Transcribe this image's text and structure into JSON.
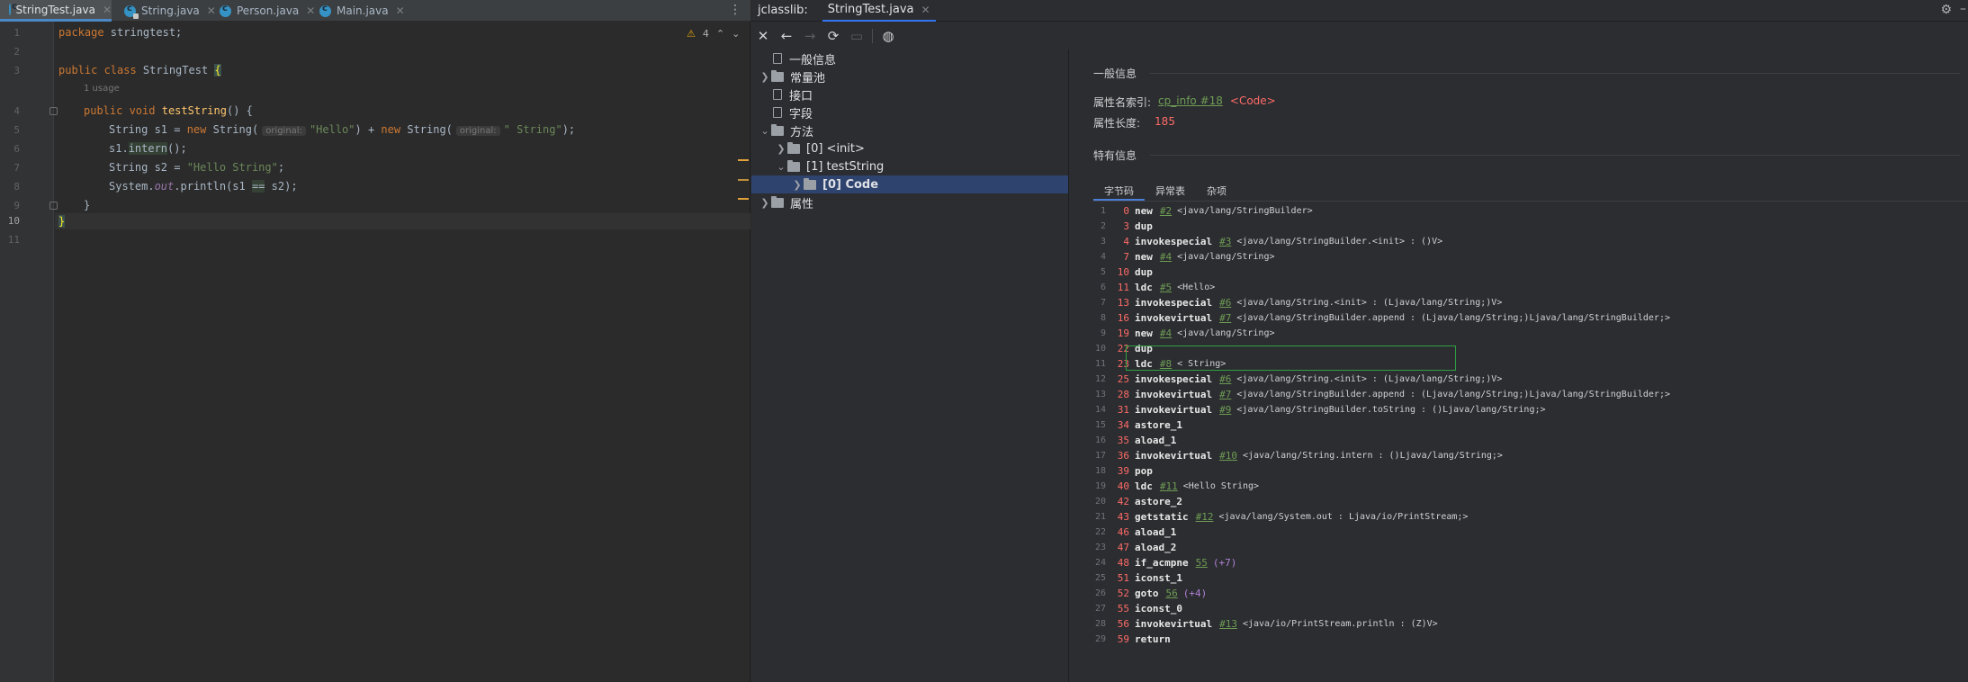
{
  "editor": {
    "tabs": [
      {
        "label": "StringTest.java",
        "active": true
      },
      {
        "label": "String.java",
        "active": false
      },
      {
        "label": "Person.java",
        "active": false
      },
      {
        "label": "Main.java",
        "active": false
      }
    ],
    "warnings": "4",
    "usage_hint": "1 usage",
    "line_numbers": [
      "1",
      "2",
      "3",
      "4",
      "5",
      "6",
      "7",
      "8",
      "9",
      "10",
      "11"
    ],
    "code": {
      "l1_kw": "package",
      "l1_rest": " stringtest;",
      "l3_kw": "public class",
      "l3_name": " StringTest ",
      "l3_brace": "{",
      "l4_kw": "public void",
      "l4_name": "testString",
      "l4_rest": "() {",
      "l5_a": "String s1 = ",
      "l5_new1": "new",
      "l5_b": " String(",
      "l5_hint": "original:",
      "l5_s1": "\"Hello\"",
      "l5_c": ") + ",
      "l5_new2": "new",
      "l5_d": " String(",
      "l5_s2": "\" String\"",
      "l5_e": ");",
      "l6_a": "s1.",
      "l6_fn": "intern",
      "l6_b": "();",
      "l7_a": "String s2 = ",
      "l7_s": "\"Hello String\"",
      "l7_b": ";",
      "l8_a": "System.",
      "l8_out": "out",
      "l8_b": ".println(s1 ",
      "l8_eq": "==",
      "l8_c": " s2);",
      "l9": "}",
      "l10": "}"
    }
  },
  "jclasslib": {
    "label": "jclasslib:",
    "file_tab": "StringTest.java",
    "tree": [
      {
        "label": "一般信息",
        "type": "doc"
      },
      {
        "label": "常量池",
        "type": "folder"
      },
      {
        "label": "接口",
        "type": "doc"
      },
      {
        "label": "字段",
        "type": "doc"
      },
      {
        "label": "方法",
        "type": "folder"
      },
      {
        "label": "[0] <init>",
        "type": "folder"
      },
      {
        "label": "[1] testString",
        "type": "folder"
      },
      {
        "label": "[0] Code",
        "type": "folder"
      },
      {
        "label": "属性",
        "type": "folder"
      }
    ],
    "general_title": "一般信息",
    "attr_name_index_label": "属性名索引:",
    "attr_name_index_link": "cp_info #18",
    "attr_name_index_value": "<Code>",
    "attr_length_label": "属性长度:",
    "attr_length_value": "185",
    "specific_title": "特有信息",
    "sub_tabs": [
      "字节码",
      "异常表",
      "杂项"
    ],
    "bytecode": [
      {
        "ln": "1",
        "off": "0",
        "op": "new",
        "ref": "#2",
        "arg": "<java/lang/StringBuilder>"
      },
      {
        "ln": "2",
        "off": "3",
        "op": "dup",
        "ref": "",
        "arg": ""
      },
      {
        "ln": "3",
        "off": "4",
        "op": "invokespecial",
        "ref": "#3",
        "arg": "<java/lang/StringBuilder.<init> : ()V>"
      },
      {
        "ln": "4",
        "off": "7",
        "op": "new",
        "ref": "#4",
        "arg": "<java/lang/String>"
      },
      {
        "ln": "5",
        "off": "10",
        "op": "dup",
        "ref": "",
        "arg": ""
      },
      {
        "ln": "6",
        "off": "11",
        "op": "ldc",
        "ref": "#5",
        "arg": "<Hello>"
      },
      {
        "ln": "7",
        "off": "13",
        "op": "invokespecial",
        "ref": "#6",
        "arg": "<java/lang/String.<init> : (Ljava/lang/String;)V>"
      },
      {
        "ln": "8",
        "off": "16",
        "op": "invokevirtual",
        "ref": "#7",
        "arg": "<java/lang/StringBuilder.append : (Ljava/lang/String;)Ljava/lang/StringBuilder;>"
      },
      {
        "ln": "9",
        "off": "19",
        "op": "new",
        "ref": "#4",
        "arg": "<java/lang/String>"
      },
      {
        "ln": "10",
        "off": "22",
        "op": "dup",
        "ref": "",
        "arg": ""
      },
      {
        "ln": "11",
        "off": "23",
        "op": "ldc",
        "ref": "#8",
        "arg": "< String>"
      },
      {
        "ln": "12",
        "off": "25",
        "op": "invokespecial",
        "ref": "#6",
        "arg": "<java/lang/String.<init> : (Ljava/lang/String;)V>"
      },
      {
        "ln": "13",
        "off": "28",
        "op": "invokevirtual",
        "ref": "#7",
        "arg": "<java/lang/StringBuilder.append : (Ljava/lang/String;)Ljava/lang/StringBuilder;>"
      },
      {
        "ln": "14",
        "off": "31",
        "op": "invokevirtual",
        "ref": "#9",
        "arg": "<java/lang/StringBuilder.toString : ()Ljava/lang/String;>"
      },
      {
        "ln": "15",
        "off": "34",
        "op": "astore_1",
        "ref": "",
        "arg": ""
      },
      {
        "ln": "16",
        "off": "35",
        "op": "aload_1",
        "ref": "",
        "arg": ""
      },
      {
        "ln": "17",
        "off": "36",
        "op": "invokevirtual",
        "ref": "#10",
        "arg": "<java/lang/String.intern : ()Ljava/lang/String;>"
      },
      {
        "ln": "18",
        "off": "39",
        "op": "pop",
        "ref": "",
        "arg": ""
      },
      {
        "ln": "19",
        "off": "40",
        "op": "ldc",
        "ref": "#11",
        "arg": "<Hello String>"
      },
      {
        "ln": "20",
        "off": "42",
        "op": "astore_2",
        "ref": "",
        "arg": ""
      },
      {
        "ln": "21",
        "off": "43",
        "op": "getstatic",
        "ref": "#12",
        "arg": "<java/lang/System.out : Ljava/io/PrintStream;>"
      },
      {
        "ln": "22",
        "off": "46",
        "op": "aload_1",
        "ref": "",
        "arg": ""
      },
      {
        "ln": "23",
        "off": "47",
        "op": "aload_2",
        "ref": "",
        "arg": ""
      },
      {
        "ln": "24",
        "off": "48",
        "op": "if_acmpne",
        "ref": "55",
        "arg": "",
        "jmp": "(+7)"
      },
      {
        "ln": "25",
        "off": "51",
        "op": "iconst_1",
        "ref": "",
        "arg": ""
      },
      {
        "ln": "26",
        "off": "52",
        "op": "goto",
        "ref": "56",
        "arg": "",
        "jmp": "(+4)"
      },
      {
        "ln": "27",
        "off": "55",
        "op": "iconst_0",
        "ref": "",
        "arg": ""
      },
      {
        "ln": "28",
        "off": "56",
        "op": "invokevirtual",
        "ref": "#13",
        "arg": "<java/io/PrintStream.println : (Z)V>"
      },
      {
        "ln": "29",
        "off": "59",
        "op": "return",
        "ref": "",
        "arg": ""
      }
    ]
  },
  "colors": {
    "editor_bg": "#2b2b2b",
    "keyword": "#cc7832",
    "string": "#6a8759",
    "offset": "#ff6b68",
    "ref_link": "#6f9c55",
    "highlight_box": "#2ea043"
  }
}
